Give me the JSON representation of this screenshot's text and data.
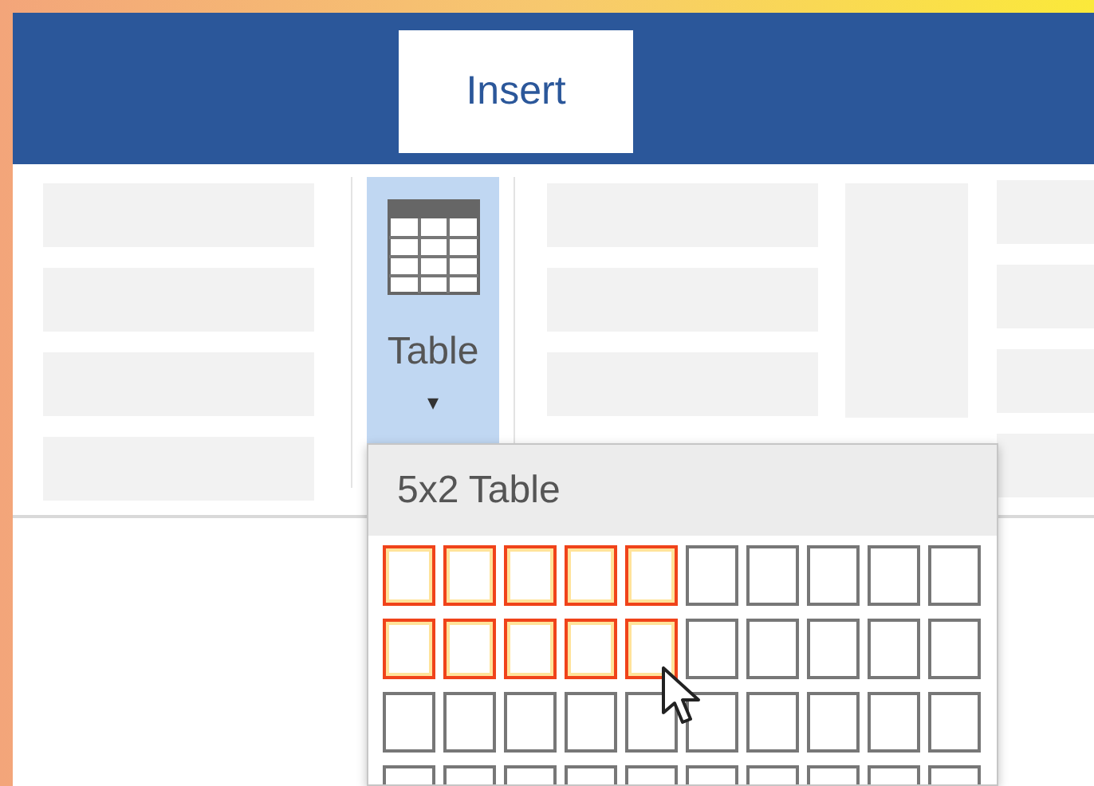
{
  "tabs": [
    {
      "label": "Insert",
      "selected": true
    }
  ],
  "table_button": {
    "label": "Table",
    "caret": "▾",
    "expanded": true
  },
  "table_menu": {
    "title": "5x2 Table",
    "grid": [
      [
        {
          "selected": true
        },
        {
          "selected": true
        },
        {
          "selected": true
        },
        {
          "selected": true
        },
        {
          "selected": true
        },
        {
          "selected": false
        },
        {
          "selected": false
        },
        {
          "selected": false
        },
        {
          "selected": false
        },
        {
          "selected": false
        }
      ],
      [
        {
          "selected": true
        },
        {
          "selected": true
        },
        {
          "selected": true
        },
        {
          "selected": true
        },
        {
          "selected": true
        },
        {
          "selected": false
        },
        {
          "selected": false
        },
        {
          "selected": false
        },
        {
          "selected": false
        },
        {
          "selected": false
        }
      ],
      [
        {
          "selected": false
        },
        {
          "selected": false
        },
        {
          "selected": false
        },
        {
          "selected": false
        },
        {
          "selected": false
        },
        {
          "selected": false
        },
        {
          "selected": false
        },
        {
          "selected": false
        },
        {
          "selected": false
        },
        {
          "selected": false
        }
      ],
      [
        {
          "selected": false
        },
        {
          "selected": false
        },
        {
          "selected": false
        },
        {
          "selected": false
        },
        {
          "selected": false
        },
        {
          "selected": false
        },
        {
          "selected": false
        },
        {
          "selected": false
        },
        {
          "selected": false
        },
        {
          "selected": false
        }
      ]
    ]
  }
}
